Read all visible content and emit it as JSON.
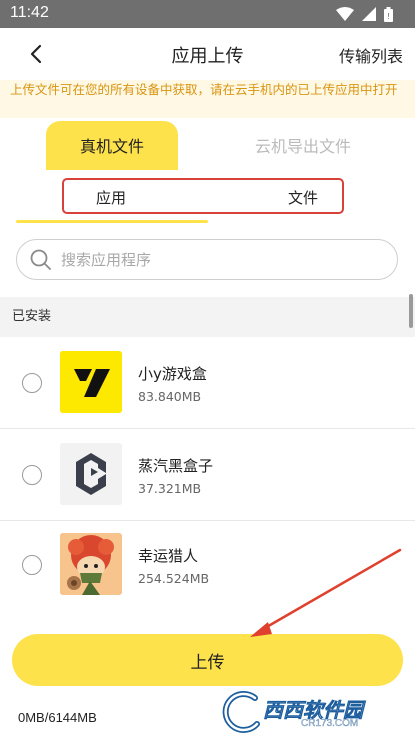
{
  "status_bar": {
    "time": "11:42",
    "icons": [
      "wifi-icon",
      "signal-icon",
      "battery-icon"
    ]
  },
  "header": {
    "title": "应用上传",
    "right_link": "传输列表"
  },
  "notice": "上传文件可在您的所有设备中获取，请在云手机内的已上传应用中打开",
  "tabs": [
    {
      "label": "真机文件",
      "active": true
    },
    {
      "label": "云机导出文件",
      "active": false
    }
  ],
  "subtabs": [
    {
      "label": "应用",
      "active": true
    },
    {
      "label": "文件",
      "active": false
    }
  ],
  "search": {
    "placeholder": "搜索应用程序",
    "value": ""
  },
  "section": {
    "title": "已安装"
  },
  "apps": [
    {
      "name": "小y游戏盒",
      "size": "83.840MB",
      "selected": false
    },
    {
      "name": "蒸汽黑盒子",
      "size": "37.321MB",
      "selected": false
    },
    {
      "name": "幸运猎人",
      "size": "254.524MB",
      "selected": false
    }
  ],
  "upload_button": "上传",
  "storage": "0MB/6144MB",
  "watermark": {
    "brand": "西西软件园",
    "domain": "CR173.COM"
  },
  "colors": {
    "accent": "#fde24b",
    "notice_text": "#d99410",
    "annotation_red": "#d8403a"
  }
}
